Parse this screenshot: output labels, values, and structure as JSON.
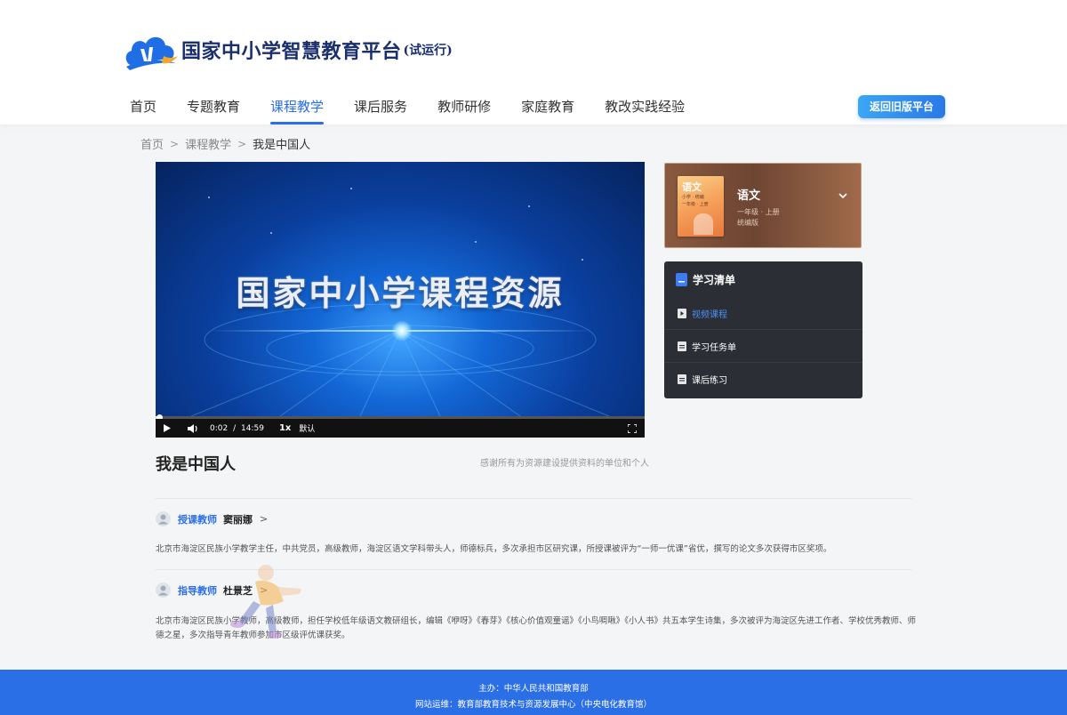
{
  "header": {
    "logo_title": "国家中小学智慧教育平台",
    "logo_sub": "(试运行)",
    "nav": [
      {
        "label": "首页",
        "active": false
      },
      {
        "label": "专题教育",
        "active": false
      },
      {
        "label": "课程教学",
        "active": true
      },
      {
        "label": "课后服务",
        "active": false
      },
      {
        "label": "教师研修",
        "active": false
      },
      {
        "label": "家庭教育",
        "active": false
      },
      {
        "label": "教改实践经验",
        "active": false
      }
    ],
    "old_platform_button": "返回旧版平台"
  },
  "breadcrumb": {
    "items": [
      "首页",
      "课程教学",
      "我是中国人"
    ],
    "separator": ">"
  },
  "video": {
    "screen_title": "国家中小学课程资源",
    "current_time": "0:02",
    "time_separator": "/",
    "duration": "14:59",
    "rate": "1x",
    "quality": "默认",
    "progress_fraction": 0.0022
  },
  "lesson": {
    "title": "我是中国人",
    "thanks": "感谢所有为资源建设提供资料的单位和个人"
  },
  "subject": {
    "name": "语文",
    "grade": "一年级 · 上册",
    "edition": "统编版",
    "book_title": "语文",
    "book_sub1": "小学 · 统编",
    "book_sub2": "一年级 · 上册"
  },
  "study_list": {
    "title": "学习清单",
    "items": [
      {
        "label": "视频课程",
        "active": true
      },
      {
        "label": "学习任务单",
        "active": false
      },
      {
        "label": "课后练习",
        "active": false
      }
    ]
  },
  "teachers": [
    {
      "role": "授课教师",
      "name": "窦丽娜",
      "arrow": ">",
      "desc": "北京市海淀区民族小学教学主任，中共党员，高级教师，海淀区语文学科带头人，师德标兵，多次承担市区研究课，所授课被评为“一师一优课”省优，撰写的论文多次获得市区奖项。"
    },
    {
      "role": "指导教师",
      "name": "杜景芝",
      "arrow": ">",
      "desc": "北京市海淀区民族小学教师，高级教师，担任学校低年级语文教研组长，编辑《咿呀》《春芽》《核心价值观童谣》《小鸟啁啾》《小人书》共五本学生诗集，多次被评为海淀区先进工作者、学校优秀教师、师德之星，多次指导青年教师参加市区级评优课获奖。"
    }
  ],
  "footer": {
    "line1": "主办：中华人民共和国教育部",
    "line2": "网站运维：教育部教育技术与资源发展中心（中央电化教育馆）"
  },
  "colors": {
    "accent": "#2a6ee8",
    "footer": "#2b6fe6",
    "study_bg": "#2c2e36"
  }
}
